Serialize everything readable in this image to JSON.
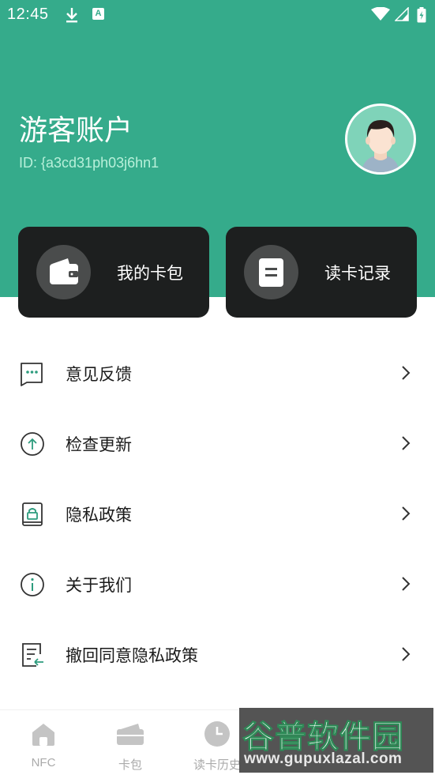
{
  "status_bar": {
    "time": "12:45",
    "icons": [
      "download-icon",
      "a-icon",
      "wifi-icon",
      "signal-icon",
      "battery-icon"
    ],
    "a_icon_text": "A"
  },
  "header": {
    "title": "游客账户",
    "account_id": "ID: {a3cd31ph03j6hn1",
    "background_color": "#35ab8b"
  },
  "action_cards": [
    {
      "label": "我的卡包",
      "icon": "wallet-icon"
    },
    {
      "label": "读卡记录",
      "icon": "document-icon"
    }
  ],
  "menu": {
    "items": [
      {
        "label": "意见反馈",
        "icon": "feedback-icon"
      },
      {
        "label": "检查更新",
        "icon": "update-icon"
      },
      {
        "label": "隐私政策",
        "icon": "privacy-icon"
      },
      {
        "label": "关于我们",
        "icon": "info-icon"
      },
      {
        "label": "撤回同意隐私政策",
        "icon": "revoke-icon"
      }
    ]
  },
  "bottom_nav": {
    "items": [
      {
        "label": "NFC",
        "icon": "home-icon"
      },
      {
        "label": "卡包",
        "icon": "wallet-icon"
      },
      {
        "label": "读卡历史",
        "icon": "clock-icon"
      }
    ]
  },
  "watermark": {
    "logo_text": "谷普软件园",
    "url": "www.gupuxlazal.com"
  },
  "colors": {
    "accent": "#35ab8b",
    "card_background": "#1d1f1f",
    "icon_accent": "#2e9c7e"
  }
}
